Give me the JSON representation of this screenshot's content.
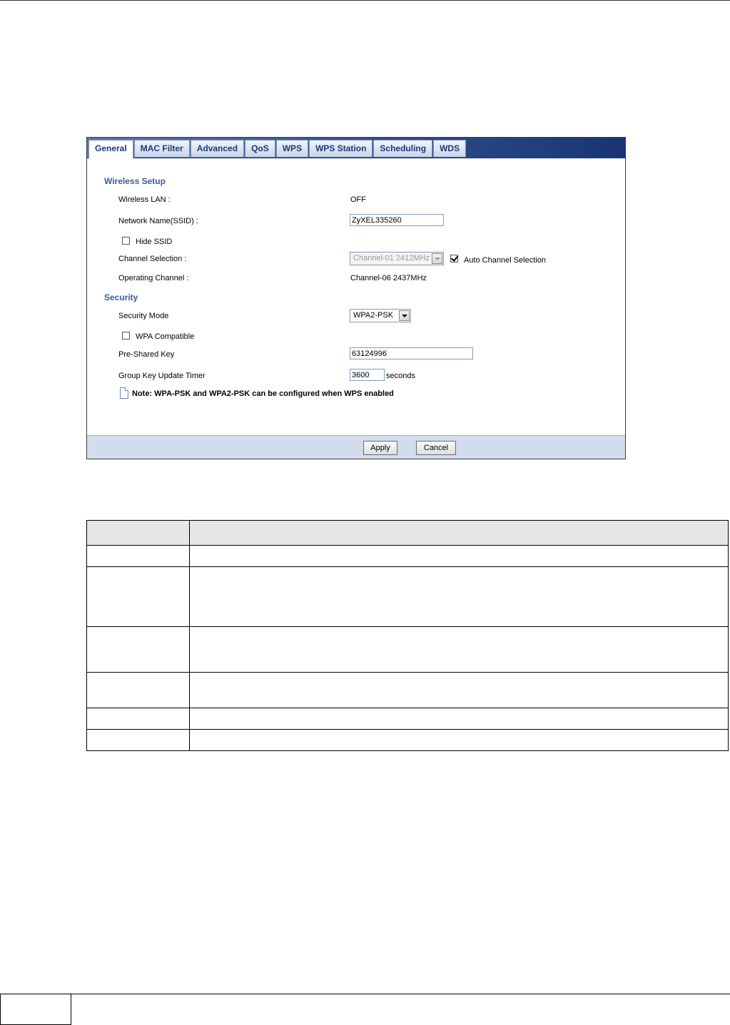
{
  "tabs": [
    "General",
    "MAC Filter",
    "Advanced",
    "QoS",
    "WPS",
    "WPS Station",
    "Scheduling",
    "WDS"
  ],
  "active_tab": "General",
  "wireless_setup": {
    "title": "Wireless Setup",
    "wireless_lan_label": "Wireless LAN :",
    "wireless_lan_value": "OFF",
    "ssid_label": "Network Name(SSID) :",
    "ssid_value": "ZyXEL335260",
    "hide_ssid_label": "Hide SSID",
    "hide_ssid_checked": false,
    "channel_selection_label": "Channel Selection :",
    "channel_selection_value": "Channel-01 2412MHz",
    "auto_channel_label": "Auto Channel Selection",
    "auto_channel_checked": true,
    "operating_channel_label": "Operating Channel :",
    "operating_channel_value": "Channel-06 2437MHz"
  },
  "security": {
    "title": "Security",
    "mode_label": "Security Mode",
    "mode_value": "WPA2-PSK",
    "wpa_compatible_label": "WPA Compatible",
    "wpa_compatible_checked": false,
    "psk_label": "Pre-Shared Key",
    "psk_value": "63124996",
    "timer_label": "Group Key Update Timer",
    "timer_value": "3600",
    "timer_unit": "seconds"
  },
  "note": "Note: WPA-PSK and WPA2-PSK can be configured when WPS enabled",
  "buttons": {
    "apply": "Apply",
    "cancel": "Cancel"
  }
}
